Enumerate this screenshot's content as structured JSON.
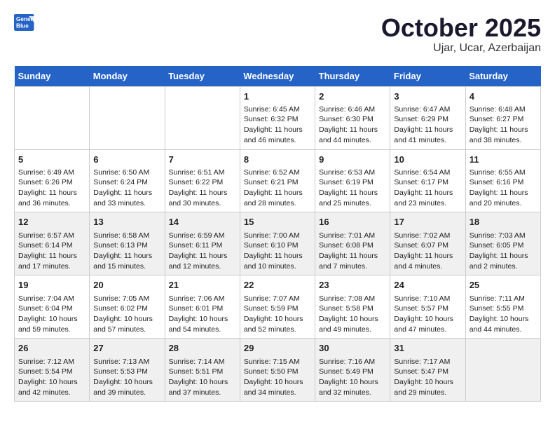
{
  "logo": {
    "line1": "General",
    "line2": "Blue"
  },
  "title": "October 2025",
  "subtitle": "Ujar, Ucar, Azerbaijan",
  "weekdays": [
    "Sunday",
    "Monday",
    "Tuesday",
    "Wednesday",
    "Thursday",
    "Friday",
    "Saturday"
  ],
  "weeks": [
    [
      {
        "day": "",
        "info": ""
      },
      {
        "day": "",
        "info": ""
      },
      {
        "day": "",
        "info": ""
      },
      {
        "day": "1",
        "info": "Sunrise: 6:45 AM\nSunset: 6:32 PM\nDaylight: 11 hours\nand 46 minutes."
      },
      {
        "day": "2",
        "info": "Sunrise: 6:46 AM\nSunset: 6:30 PM\nDaylight: 11 hours\nand 44 minutes."
      },
      {
        "day": "3",
        "info": "Sunrise: 6:47 AM\nSunset: 6:29 PM\nDaylight: 11 hours\nand 41 minutes."
      },
      {
        "day": "4",
        "info": "Sunrise: 6:48 AM\nSunset: 6:27 PM\nDaylight: 11 hours\nand 38 minutes."
      }
    ],
    [
      {
        "day": "5",
        "info": "Sunrise: 6:49 AM\nSunset: 6:26 PM\nDaylight: 11 hours\nand 36 minutes."
      },
      {
        "day": "6",
        "info": "Sunrise: 6:50 AM\nSunset: 6:24 PM\nDaylight: 11 hours\nand 33 minutes."
      },
      {
        "day": "7",
        "info": "Sunrise: 6:51 AM\nSunset: 6:22 PM\nDaylight: 11 hours\nand 30 minutes."
      },
      {
        "day": "8",
        "info": "Sunrise: 6:52 AM\nSunset: 6:21 PM\nDaylight: 11 hours\nand 28 minutes."
      },
      {
        "day": "9",
        "info": "Sunrise: 6:53 AM\nSunset: 6:19 PM\nDaylight: 11 hours\nand 25 minutes."
      },
      {
        "day": "10",
        "info": "Sunrise: 6:54 AM\nSunset: 6:17 PM\nDaylight: 11 hours\nand 23 minutes."
      },
      {
        "day": "11",
        "info": "Sunrise: 6:55 AM\nSunset: 6:16 PM\nDaylight: 11 hours\nand 20 minutes."
      }
    ],
    [
      {
        "day": "12",
        "info": "Sunrise: 6:57 AM\nSunset: 6:14 PM\nDaylight: 11 hours\nand 17 minutes."
      },
      {
        "day": "13",
        "info": "Sunrise: 6:58 AM\nSunset: 6:13 PM\nDaylight: 11 hours\nand 15 minutes."
      },
      {
        "day": "14",
        "info": "Sunrise: 6:59 AM\nSunset: 6:11 PM\nDaylight: 11 hours\nand 12 minutes."
      },
      {
        "day": "15",
        "info": "Sunrise: 7:00 AM\nSunset: 6:10 PM\nDaylight: 11 hours\nand 10 minutes."
      },
      {
        "day": "16",
        "info": "Sunrise: 7:01 AM\nSunset: 6:08 PM\nDaylight: 11 hours\nand 7 minutes."
      },
      {
        "day": "17",
        "info": "Sunrise: 7:02 AM\nSunset: 6:07 PM\nDaylight: 11 hours\nand 4 minutes."
      },
      {
        "day": "18",
        "info": "Sunrise: 7:03 AM\nSunset: 6:05 PM\nDaylight: 11 hours\nand 2 minutes."
      }
    ],
    [
      {
        "day": "19",
        "info": "Sunrise: 7:04 AM\nSunset: 6:04 PM\nDaylight: 10 hours\nand 59 minutes."
      },
      {
        "day": "20",
        "info": "Sunrise: 7:05 AM\nSunset: 6:02 PM\nDaylight: 10 hours\nand 57 minutes."
      },
      {
        "day": "21",
        "info": "Sunrise: 7:06 AM\nSunset: 6:01 PM\nDaylight: 10 hours\nand 54 minutes."
      },
      {
        "day": "22",
        "info": "Sunrise: 7:07 AM\nSunset: 5:59 PM\nDaylight: 10 hours\nand 52 minutes."
      },
      {
        "day": "23",
        "info": "Sunrise: 7:08 AM\nSunset: 5:58 PM\nDaylight: 10 hours\nand 49 minutes."
      },
      {
        "day": "24",
        "info": "Sunrise: 7:10 AM\nSunset: 5:57 PM\nDaylight: 10 hours\nand 47 minutes."
      },
      {
        "day": "25",
        "info": "Sunrise: 7:11 AM\nSunset: 5:55 PM\nDaylight: 10 hours\nand 44 minutes."
      }
    ],
    [
      {
        "day": "26",
        "info": "Sunrise: 7:12 AM\nSunset: 5:54 PM\nDaylight: 10 hours\nand 42 minutes."
      },
      {
        "day": "27",
        "info": "Sunrise: 7:13 AM\nSunset: 5:53 PM\nDaylight: 10 hours\nand 39 minutes."
      },
      {
        "day": "28",
        "info": "Sunrise: 7:14 AM\nSunset: 5:51 PM\nDaylight: 10 hours\nand 37 minutes."
      },
      {
        "day": "29",
        "info": "Sunrise: 7:15 AM\nSunset: 5:50 PM\nDaylight: 10 hours\nand 34 minutes."
      },
      {
        "day": "30",
        "info": "Sunrise: 7:16 AM\nSunset: 5:49 PM\nDaylight: 10 hours\nand 32 minutes."
      },
      {
        "day": "31",
        "info": "Sunrise: 7:17 AM\nSunset: 5:47 PM\nDaylight: 10 hours\nand 29 minutes."
      },
      {
        "day": "",
        "info": ""
      }
    ]
  ]
}
